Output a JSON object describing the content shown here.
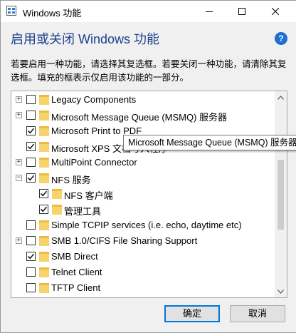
{
  "window": {
    "title": "Windows 功能"
  },
  "heading": "启用或关闭 Windows 功能",
  "description": "若要启用一种功能，请选择其复选框。若要关闭一种功能，请清除其复选框。填充的框表示仅启用该功能的一部分。",
  "features": [
    {
      "label": "Legacy Components",
      "checked": false,
      "expander": "+",
      "indent": 0
    },
    {
      "label": "Microsoft Message Queue (MSMQ) 服务器",
      "checked": false,
      "expander": "+",
      "indent": 0
    },
    {
      "label": "Microsoft Print to PDF",
      "checked": true,
      "expander": "",
      "indent": 0
    },
    {
      "label": "Microsoft XPS 文档写入程序",
      "checked": true,
      "expander": "",
      "indent": 0
    },
    {
      "label": "MultiPoint Connector",
      "checked": false,
      "expander": "+",
      "indent": 0
    },
    {
      "label": "NFS 服务",
      "checked": true,
      "expander": "−",
      "indent": 0
    },
    {
      "label": "NFS 客户端",
      "checked": true,
      "expander": "",
      "indent": 1
    },
    {
      "label": "管理工具",
      "checked": true,
      "expander": "",
      "indent": 1
    },
    {
      "label": "Simple TCPIP services (i.e. echo, daytime etc)",
      "checked": false,
      "expander": "",
      "indent": 0
    },
    {
      "label": "SMB 1.0/CIFS File Sharing Support",
      "checked": false,
      "expander": "+",
      "indent": 0
    },
    {
      "label": "SMB Direct",
      "checked": true,
      "expander": "",
      "indent": 0
    },
    {
      "label": "Telnet Client",
      "checked": false,
      "expander": "",
      "indent": 0
    },
    {
      "label": "TFTP Client",
      "checked": false,
      "expander": "",
      "indent": 0
    }
  ],
  "tooltip": "Microsoft Message Queue (MSMQ) 服务器",
  "buttons": {
    "ok": "确定",
    "cancel": "取消"
  },
  "colors": {
    "heading": "#1e3f8e",
    "folder": "#f7d46b",
    "accent": "#0078d7"
  }
}
